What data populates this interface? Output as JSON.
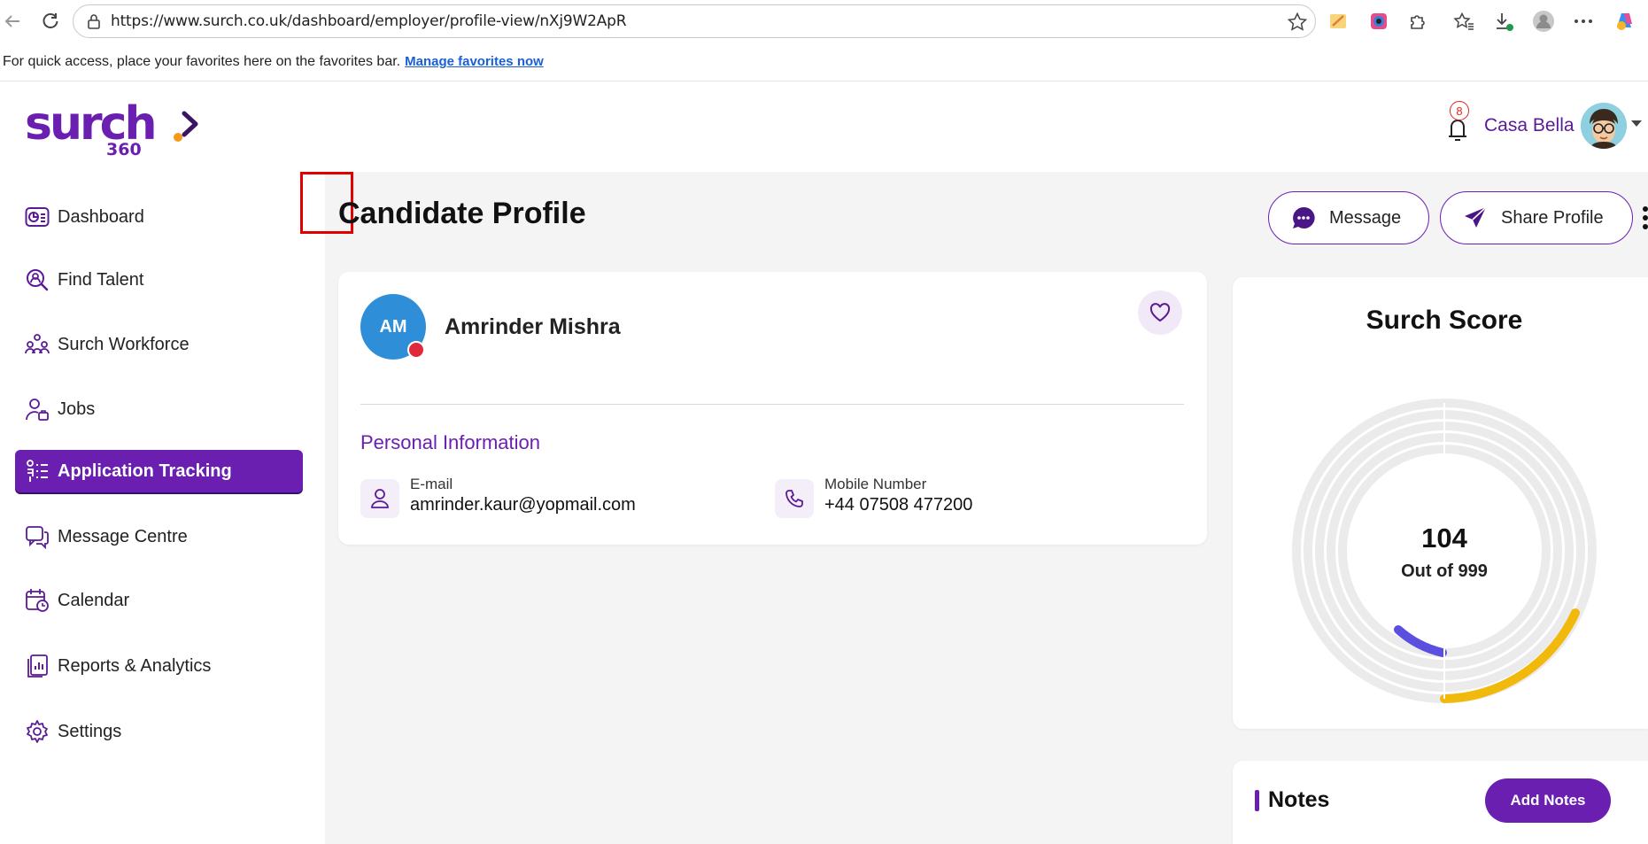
{
  "browser": {
    "url": "https://www.surch.co.uk/dashboard/employer/profile-view/nXj9W2ApR",
    "favorites_text": "For quick access, place your favorites here on the favorites bar.",
    "favorites_link": "Manage favorites now"
  },
  "header": {
    "logo_word": "surch",
    "logo_num": "360",
    "notification_count": "8",
    "user_name": "Casa Bella"
  },
  "sidebar": {
    "items": [
      {
        "label": "Dashboard",
        "icon": "dashboard-icon"
      },
      {
        "label": "Find Talent",
        "icon": "find-talent-icon"
      },
      {
        "label": "Surch Workforce",
        "icon": "workforce-icon"
      },
      {
        "label": "Jobs",
        "icon": "jobs-icon"
      },
      {
        "label": "Application Tracking",
        "icon": "application-tracking-icon",
        "active": true
      },
      {
        "label": "Message Centre",
        "icon": "message-centre-icon"
      },
      {
        "label": "Calendar",
        "icon": "calendar-icon"
      },
      {
        "label": "Reports & Analytics",
        "icon": "reports-icon"
      },
      {
        "label": "Settings",
        "icon": "settings-icon"
      }
    ]
  },
  "main": {
    "title": "Candidate Profile",
    "message_button": "Message",
    "share_button": "Share Profile"
  },
  "candidate": {
    "initials": "AM",
    "name": "Amrinder Mishra",
    "section_title": "Personal Information",
    "email_label": "E-mail",
    "email": "amrinder.kaur@yopmail.com",
    "mobile_label": "Mobile Number",
    "mobile": "+44 07508 477200"
  },
  "score": {
    "title": "Surch Score",
    "value": "104",
    "out_of": "Out of 999",
    "colors": {
      "accent": "#6a1fb1",
      "inner_arc": "#5b4fe0",
      "outer_arc": "#f0b90b",
      "track": "#ebebeb"
    }
  },
  "notes": {
    "title": "Notes",
    "add_button": "Add Notes"
  }
}
